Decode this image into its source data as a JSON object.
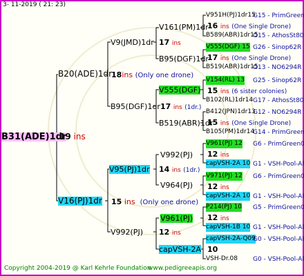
{
  "header": "3- 11-2019 (  21: 23)",
  "footer": {
    "copyright": "Copyright 2004-2019 @ Karl Kehrle Foundation",
    "site": "www.pedigreeapis.org"
  },
  "root": {
    "name": "B31(ADE)1dr",
    "num": "19",
    "ins": "ins"
  },
  "gen1": [
    {
      "name": "B20(ADE)1dr",
      "num": "18",
      "ins": "ins",
      "note": "(Only one drone)"
    },
    {
      "name": "V16(PJ)1dr",
      "num": "15",
      "ins": "ins",
      "note": "(Only one drone)"
    }
  ],
  "gen2": [
    {
      "name": "V9(JMD)1dr",
      "num": "17",
      "ins": "ins"
    },
    {
      "name": "B95(DGF)1dr",
      "num": "17",
      "ins": "ins",
      "note": "(1dr.)"
    },
    {
      "name": "V95(PJ)1dr",
      "num": "14",
      "ins": "ins",
      "note": "(1dr.)"
    },
    {
      "name": "V992(PJ)",
      "num": "12",
      "ins": "ins"
    }
  ],
  "gen3": [
    {
      "name": "V161(PM)1dr",
      "num": "17",
      "ins": "ins"
    },
    {
      "name": "B95(DGF)1dr",
      "num": "17",
      "ins": "ins"
    },
    {
      "name": "V555(DGF)",
      "num": "15",
      "ins": "ins"
    },
    {
      "name": "B519(ABR)1dr",
      "num": "15",
      "ins": "ins"
    },
    {
      "name": "V992(PJ)",
      "num": "",
      "ins": ""
    },
    {
      "name": "V964(PJ)",
      "num": "",
      "ins": ""
    },
    {
      "name": "V961(PJ)",
      "num": "",
      "ins": ""
    },
    {
      "name": "capVSH-2A",
      "num": "",
      "ins": ""
    }
  ],
  "gen4": [
    {
      "a": "V951H(PJ)1dr",
      "ar": "15",
      "ad": "G15 - PrimGreen00",
      "num": "16",
      "ins": "ins",
      "note": "(One Single Drone)",
      "b": "B589(ABR)1dr",
      "br": "15",
      "bd": "G15 - AthosSt80R"
    },
    {
      "a": "V555(DGF) 15",
      "ar": "",
      "ad": "G26 - Sinop62R",
      "num": "17",
      "ins": "ins",
      "note": "(One Single Drone)",
      "b": "B519(ABR)1dr",
      "br": "15",
      "bd": "G13 - NO6294R"
    },
    {
      "a": "V154(RL) 13",
      "ar": "",
      "ad": "G25 - Sinop62R",
      "num": "15",
      "ins": "ins",
      "note": "(6 sister colonies)",
      "b": "B102(RL)1dr",
      "br": "14",
      "bd": "G17 - AthosSt80R"
    },
    {
      "a": "B412(JPN)1dr",
      "ar": "13",
      "ad": "G12 - NO6294R",
      "num": "15",
      "ins": "ins",
      "note": "(One Single Drone)",
      "b": "B105(PM)1dr",
      "br": "14",
      "bd": "G14 - PrimGreen00"
    },
    {
      "a": "V961(PJ) 12",
      "ar": "",
      "ad": "G6 - PrimGreen00",
      "num": "12",
      "ins": "ins",
      "note": "",
      "b": "capVSH-2A 10",
      "br": "",
      "bd": "G1 - VSH-Pool-AR"
    },
    {
      "a": "V971(PJ) 12",
      "ar": "",
      "ad": "G6 - PrimGreen00",
      "num": "12",
      "ins": "ins",
      "note": "",
      "b": "capVSH-2A 10",
      "br": "",
      "bd": "G1 - VSH-Pool-AR"
    },
    {
      "a": "P214(PJ) 10",
      "ar": "",
      "ad": "G5 - PrimGreen00",
      "num": "12",
      "ins": "ins",
      "note": "",
      "b": "capVSH-1B 10",
      "br": "",
      "bd": "G1 - VSH-Pool-AR"
    },
    {
      "a": "capVSH-2A-Q",
      "ar": "09",
      "ad": "G0 - VSH-Pool-AR",
      "num": "10",
      "ins": "",
      "note": "",
      "b": "VSH-Dr.08",
      "br": "",
      "bd": "G0 - VSH-Pool-AR"
    }
  ],
  "colors": {
    "frame": "#c400c4",
    "green": "#22dd22",
    "cyan": "#22d4f4",
    "pink": "#ffc0ff",
    "ins": "#cc0000"
  }
}
